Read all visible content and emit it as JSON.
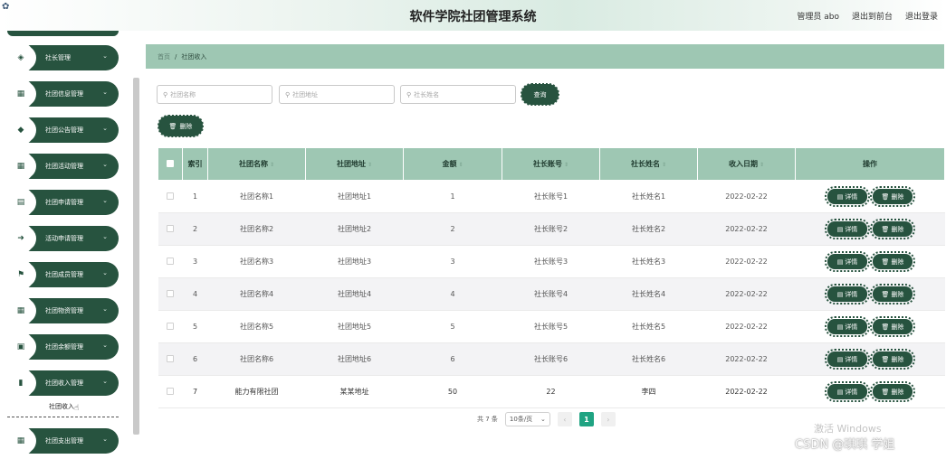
{
  "header": {
    "title": "软件学院社团管理系统",
    "admin_label": "管理员 abo",
    "exit_front": "退出到前台",
    "exit_login": "退出登录"
  },
  "sidebar": {
    "items": [
      {
        "label": "社长管理",
        "icon": "shield-icon",
        "glyph": "◈"
      },
      {
        "label": "社团信息管理",
        "icon": "grid-icon",
        "glyph": "▦"
      },
      {
        "label": "社团公告管理",
        "icon": "location-icon",
        "glyph": "◆"
      },
      {
        "label": "社团活动管理",
        "icon": "grid-icon",
        "glyph": "▦"
      },
      {
        "label": "社团申请管理",
        "icon": "document-icon",
        "glyph": "▤"
      },
      {
        "label": "活动申请管理",
        "icon": "arrow-icon",
        "glyph": "➜"
      },
      {
        "label": "社团成员管理",
        "icon": "flag-icon",
        "glyph": "⚑"
      },
      {
        "label": "社团物资管理",
        "icon": "grid-icon",
        "glyph": "▦"
      },
      {
        "label": "社团余额管理",
        "icon": "film-icon",
        "glyph": "▣"
      },
      {
        "label": "社团收入管理",
        "icon": "bar-chart-icon",
        "glyph": "▮"
      },
      {
        "label": "社团支出管理",
        "icon": "grid-icon",
        "glyph": "▦"
      }
    ],
    "submenu_label": "社团收入"
  },
  "breadcrumb": {
    "home": "首页",
    "separator": "/",
    "current": "社团收入"
  },
  "search": {
    "name_placeholder": "社团名称",
    "address_placeholder": "社团地址",
    "leader_placeholder": "社长姓名",
    "query_label": "查询",
    "delete_label": "删除"
  },
  "table": {
    "headers": [
      "索引",
      "社团名称",
      "社团地址",
      "金额",
      "社长账号",
      "社长姓名",
      "收入日期",
      "操作"
    ],
    "detail_label": "详情",
    "delete_label": "删除",
    "rows": [
      [
        "1",
        "社团名称1",
        "社团地址1",
        "1",
        "社长账号1",
        "社长姓名1",
        "2022-02-22"
      ],
      [
        "2",
        "社团名称2",
        "社团地址2",
        "2",
        "社长账号2",
        "社长姓名2",
        "2022-02-22"
      ],
      [
        "3",
        "社团名称3",
        "社团地址3",
        "3",
        "社长账号3",
        "社长姓名3",
        "2022-02-22"
      ],
      [
        "4",
        "社团名称4",
        "社团地址4",
        "4",
        "社长账号4",
        "社长姓名4",
        "2022-02-22"
      ],
      [
        "5",
        "社团名称5",
        "社团地址5",
        "5",
        "社长账号5",
        "社长姓名5",
        "2022-02-22"
      ],
      [
        "6",
        "社团名称6",
        "社团地址6",
        "6",
        "社长账号6",
        "社长姓名6",
        "2022-02-22"
      ],
      [
        "7",
        "能力有限社团",
        "某某地址",
        "50",
        "22",
        "李四",
        "2022-02-22"
      ]
    ]
  },
  "pagination": {
    "total": "共 7 条",
    "page_size": "10条/页",
    "prev": "‹",
    "current_page": "1",
    "next": "›"
  },
  "watermarks": {
    "activate": "激活 Windows",
    "csdn": "CSDN @琪琪 学姐"
  },
  "colors": {
    "primary": "#27533f",
    "header_bg": "#9ec7b3",
    "active_page": "#1fa382"
  }
}
